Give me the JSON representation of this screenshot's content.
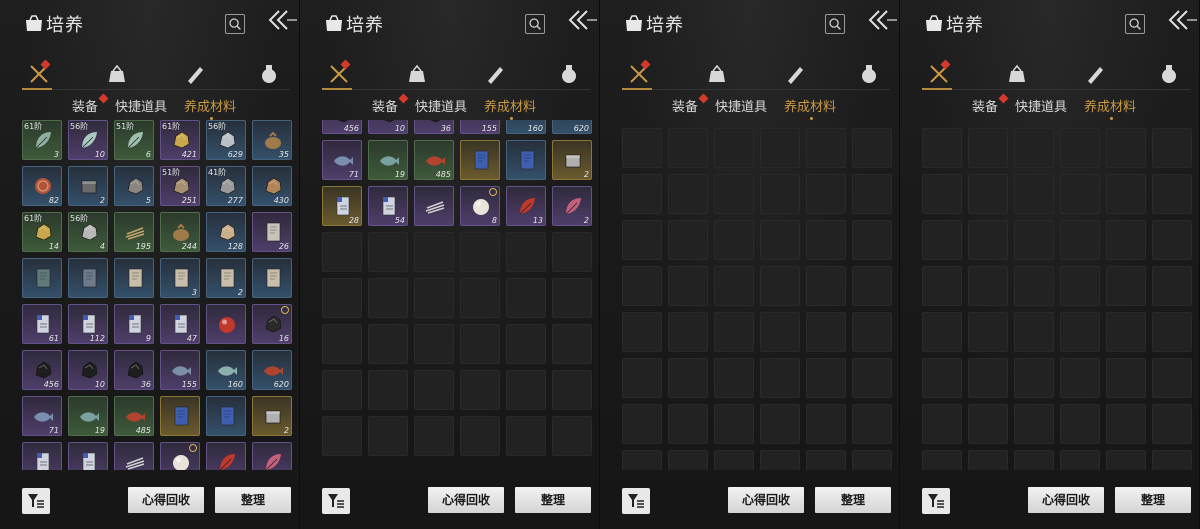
{
  "title": "培养",
  "tabs": [
    "装备",
    "快捷道具",
    "养成材料"
  ],
  "buttons": {
    "recycle": "心得回收",
    "sort": "整理"
  },
  "icons": {
    "bag": "bag-icon",
    "search": "search-icon",
    "back": "double-chevron-left-icon",
    "filter": "filter-icon",
    "categories": [
      "crossed-swords-icon",
      "pouch-icon",
      "scroll-icon",
      "potion-icon"
    ]
  },
  "colors": {
    "active_tab": "#c99a44",
    "badge": "#d43a2c"
  },
  "panels": [
    {
      "items": [
        {
          "q": "green",
          "tier": "61阶",
          "count": "3",
          "c": "#8fb0a0",
          "s": "leaf"
        },
        {
          "q": "purple",
          "tier": "56阶",
          "count": "10",
          "c": "#a9c8bf",
          "s": "leaf"
        },
        {
          "q": "green",
          "tier": "51阶",
          "count": "6",
          "c": "#9fc0b1",
          "s": "leaf"
        },
        {
          "q": "purple",
          "tier": "61阶",
          "count": "421",
          "c": "#c8a84a",
          "s": "rock"
        },
        {
          "q": "blue",
          "tier": "56阶",
          "count": "629",
          "c": "#b9c0c8",
          "s": "rock"
        },
        {
          "q": "blue",
          "tier": "",
          "count": "35",
          "c": "#a07a4a",
          "s": "sack"
        },
        {
          "q": "blue",
          "tier": "",
          "count": "82",
          "c": "#b0553a",
          "s": "disc"
        },
        {
          "q": "blue",
          "tier": "",
          "count": "2",
          "c": "#6a6a6a",
          "s": "box"
        },
        {
          "q": "blue",
          "tier": "",
          "count": "5",
          "c": "#8a8580",
          "s": "rock"
        },
        {
          "q": "purple",
          "tier": "51阶",
          "count": "251",
          "c": "#a58f73",
          "s": "rock"
        },
        {
          "q": "blue",
          "tier": "41阶",
          "count": "277",
          "c": "#9a9a9a",
          "s": "rock"
        },
        {
          "q": "blue",
          "tier": "",
          "count": "430",
          "c": "#b2845a",
          "s": "rock"
        },
        {
          "q": "green",
          "tier": "61阶",
          "count": "14",
          "c": "#c8a84a",
          "s": "rock"
        },
        {
          "q": "green",
          "tier": "56阶",
          "count": "4",
          "c": "#b8b8b8",
          "s": "rock"
        },
        {
          "q": "green",
          "tier": "",
          "count": "195",
          "c": "#c4a46e",
          "s": "sticks"
        },
        {
          "q": "green",
          "tier": "",
          "count": "244",
          "c": "#a07a4a",
          "s": "sack"
        },
        {
          "q": "blue",
          "tier": "",
          "count": "128",
          "c": "#c9b08a",
          "s": "rock"
        },
        {
          "q": "purple",
          "tier": "",
          "count": "26",
          "c": "#c9c3b8",
          "s": "book"
        },
        {
          "q": "blue",
          "tier": "",
          "count": "",
          "c": "#5f7a78",
          "s": "book"
        },
        {
          "q": "blue",
          "tier": "",
          "count": "",
          "c": "#6c7a8a",
          "s": "book"
        },
        {
          "q": "blue",
          "tier": "",
          "count": "",
          "c": "#c7bda8",
          "s": "book"
        },
        {
          "q": "blue",
          "tier": "",
          "count": "3",
          "c": "#c7bda8",
          "s": "book"
        },
        {
          "q": "blue",
          "tier": "",
          "count": "2",
          "c": "#c7bda8",
          "s": "book"
        },
        {
          "q": "blue",
          "tier": "",
          "count": "",
          "c": "#c7bda8",
          "s": "book"
        },
        {
          "q": "purple",
          "tier": "",
          "count": "61",
          "c": "#d0d4e0",
          "s": "card"
        },
        {
          "q": "purple",
          "tier": "",
          "count": "112",
          "c": "#d0d4e0",
          "s": "card"
        },
        {
          "q": "purple",
          "tier": "",
          "count": "9",
          "c": "#d0d4e0",
          "s": "card"
        },
        {
          "q": "purple",
          "tier": "",
          "count": "47",
          "c": "#d0d4e0",
          "s": "card"
        },
        {
          "q": "purple",
          "tier": "",
          "count": "",
          "c": "#c0392b",
          "s": "orb"
        },
        {
          "q": "purple",
          "tier": "",
          "count": "16",
          "c": "#2a2a2a",
          "s": "rock",
          "marker": true
        },
        {
          "q": "purple",
          "tier": "",
          "count": "456",
          "c": "#1e1e1e",
          "s": "rock"
        },
        {
          "q": "purple",
          "tier": "",
          "count": "10",
          "c": "#1e1e1e",
          "s": "rock"
        },
        {
          "q": "purple",
          "tier": "",
          "count": "36",
          "c": "#1e1e1e",
          "s": "rock"
        },
        {
          "q": "purple",
          "tier": "",
          "count": "155",
          "c": "#7c8fa8",
          "s": "fish"
        },
        {
          "q": "blue",
          "tier": "",
          "count": "160",
          "c": "#8ab0b0",
          "s": "fish"
        },
        {
          "q": "blue",
          "tier": "",
          "count": "620",
          "c": "#b0442e",
          "s": "fish"
        },
        {
          "q": "purple",
          "tier": "",
          "count": "71",
          "c": "#7a8fb0",
          "s": "fish"
        },
        {
          "q": "green",
          "tier": "",
          "count": "19",
          "c": "#7aa0a0",
          "s": "fish"
        },
        {
          "q": "green",
          "tier": "",
          "count": "485",
          "c": "#b0442e",
          "s": "fish"
        },
        {
          "q": "gold",
          "tier": "",
          "count": "",
          "c": "#3e5fb0",
          "s": "book"
        },
        {
          "q": "blue",
          "tier": "",
          "count": "",
          "c": "#3e5fb0",
          "s": "book"
        },
        {
          "q": "gold",
          "tier": "",
          "count": "2",
          "c": "#b0b0b0",
          "s": "box"
        },
        {
          "q": "purple",
          "tier": "",
          "count": "",
          "c": "#d0d4e0",
          "s": "card"
        },
        {
          "q": "purple",
          "tier": "",
          "count": "",
          "c": "#d0d4e0",
          "s": "card"
        },
        {
          "q": "purple",
          "tier": "",
          "count": "",
          "c": "#d0d0d0",
          "s": "sticks"
        },
        {
          "q": "purple",
          "tier": "",
          "count": "",
          "c": "#e8e4da",
          "s": "orb",
          "marker": true
        },
        {
          "q": "purple",
          "tier": "",
          "count": "",
          "c": "#c0392b",
          "s": "leaf"
        },
        {
          "q": "purple",
          "tier": "",
          "count": "",
          "c": "#c4607a",
          "s": "leaf"
        }
      ]
    },
    {
      "items": [
        {
          "q": "purple",
          "tier": "",
          "count": "456",
          "c": "#1e1e1e",
          "s": "rock"
        },
        {
          "q": "purple",
          "tier": "",
          "count": "10",
          "c": "#1e1e1e",
          "s": "rock"
        },
        {
          "q": "purple",
          "tier": "",
          "count": "36",
          "c": "#1e1e1e",
          "s": "rock"
        },
        {
          "q": "purple",
          "tier": "",
          "count": "155",
          "c": "#7c8fa8",
          "s": "fish"
        },
        {
          "q": "blue",
          "tier": "",
          "count": "160",
          "c": "#8ab0b0",
          "s": "fish"
        },
        {
          "q": "blue",
          "tier": "",
          "count": "620",
          "c": "#b0442e",
          "s": "fish"
        },
        {
          "q": "purple",
          "tier": "",
          "count": "71",
          "c": "#7a8fb0",
          "s": "fish"
        },
        {
          "q": "green",
          "tier": "",
          "count": "19",
          "c": "#7aa0a0",
          "s": "fish"
        },
        {
          "q": "green",
          "tier": "",
          "count": "485",
          "c": "#b0442e",
          "s": "fish"
        },
        {
          "q": "gold",
          "tier": "",
          "count": "",
          "c": "#3e5fb0",
          "s": "book"
        },
        {
          "q": "blue",
          "tier": "",
          "count": "",
          "c": "#3e5fb0",
          "s": "book"
        },
        {
          "q": "gold",
          "tier": "",
          "count": "2",
          "c": "#b0b0b0",
          "s": "box"
        },
        {
          "q": "gold",
          "tier": "",
          "count": "28",
          "c": "#d0d4e0",
          "s": "card"
        },
        {
          "q": "purple",
          "tier": "",
          "count": "54",
          "c": "#d0d4e0",
          "s": "card"
        },
        {
          "q": "purple",
          "tier": "",
          "count": "",
          "c": "#d0d0d0",
          "s": "sticks"
        },
        {
          "q": "purple",
          "tier": "",
          "count": "8",
          "c": "#e8e4da",
          "s": "orb",
          "marker": true
        },
        {
          "q": "purple",
          "tier": "",
          "count": "13",
          "c": "#c0392b",
          "s": "leaf"
        },
        {
          "q": "purple",
          "tier": "",
          "count": "2",
          "c": "#c4607a",
          "s": "leaf"
        }
      ]
    },
    {
      "items": []
    },
    {
      "items": []
    }
  ]
}
